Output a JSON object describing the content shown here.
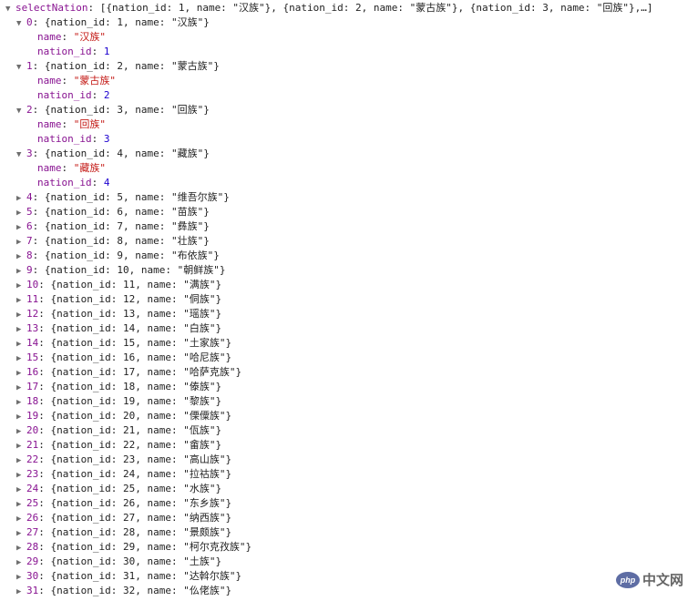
{
  "header": {
    "label": "selectNation",
    "preview": "[{nation_id: 1, name: \"汉族\"}, {nation_id: 2, name: \"蒙古族\"}, {nation_id: 3, name: \"回族\"},…]"
  },
  "icons": {
    "expanded": "triangle-down-icon",
    "collapsed": "triangle-right-icon"
  },
  "colors": {
    "key": "#881391",
    "string": "#c41a16",
    "number": "#1c00cf",
    "text": "#222222"
  },
  "items": [
    {
      "index": "0",
      "id": "1",
      "name": "汉族",
      "expanded": true
    },
    {
      "index": "1",
      "id": "2",
      "name": "蒙古族",
      "expanded": true
    },
    {
      "index": "2",
      "id": "3",
      "name": "回族",
      "expanded": true
    },
    {
      "index": "3",
      "id": "4",
      "name": "藏族",
      "expanded": true
    },
    {
      "index": "4",
      "id": "5",
      "name": "维吾尔族",
      "expanded": false
    },
    {
      "index": "5",
      "id": "6",
      "name": "苗族",
      "expanded": false
    },
    {
      "index": "6",
      "id": "7",
      "name": "彝族",
      "expanded": false
    },
    {
      "index": "7",
      "id": "8",
      "name": "壮族",
      "expanded": false
    },
    {
      "index": "8",
      "id": "9",
      "name": "布依族",
      "expanded": false
    },
    {
      "index": "9",
      "id": "10",
      "name": "朝鲜族",
      "expanded": false
    },
    {
      "index": "10",
      "id": "11",
      "name": "满族",
      "expanded": false
    },
    {
      "index": "11",
      "id": "12",
      "name": "侗族",
      "expanded": false
    },
    {
      "index": "12",
      "id": "13",
      "name": "瑶族",
      "expanded": false
    },
    {
      "index": "13",
      "id": "14",
      "name": "白族",
      "expanded": false
    },
    {
      "index": "14",
      "id": "15",
      "name": "土家族",
      "expanded": false
    },
    {
      "index": "15",
      "id": "16",
      "name": "哈尼族",
      "expanded": false
    },
    {
      "index": "16",
      "id": "17",
      "name": "哈萨克族",
      "expanded": false
    },
    {
      "index": "17",
      "id": "18",
      "name": "傣族",
      "expanded": false
    },
    {
      "index": "18",
      "id": "19",
      "name": "黎族",
      "expanded": false
    },
    {
      "index": "19",
      "id": "20",
      "name": "傈僳族",
      "expanded": false
    },
    {
      "index": "20",
      "id": "21",
      "name": "佤族",
      "expanded": false
    },
    {
      "index": "21",
      "id": "22",
      "name": "畲族",
      "expanded": false
    },
    {
      "index": "22",
      "id": "23",
      "name": "高山族",
      "expanded": false
    },
    {
      "index": "23",
      "id": "24",
      "name": "拉祜族",
      "expanded": false
    },
    {
      "index": "24",
      "id": "25",
      "name": "水族",
      "expanded": false
    },
    {
      "index": "25",
      "id": "26",
      "name": "东乡族",
      "expanded": false
    },
    {
      "index": "26",
      "id": "27",
      "name": "纳西族",
      "expanded": false
    },
    {
      "index": "27",
      "id": "28",
      "name": "景颇族",
      "expanded": false
    },
    {
      "index": "28",
      "id": "29",
      "name": "柯尔克孜族",
      "expanded": false
    },
    {
      "index": "29",
      "id": "30",
      "name": "土族",
      "expanded": false
    },
    {
      "index": "30",
      "id": "31",
      "name": "达斡尔族",
      "expanded": false
    },
    {
      "index": "31",
      "id": "32",
      "name": "仫佬族",
      "expanded": false
    }
  ],
  "watermark": {
    "badge": "php",
    "text": "中文网"
  }
}
